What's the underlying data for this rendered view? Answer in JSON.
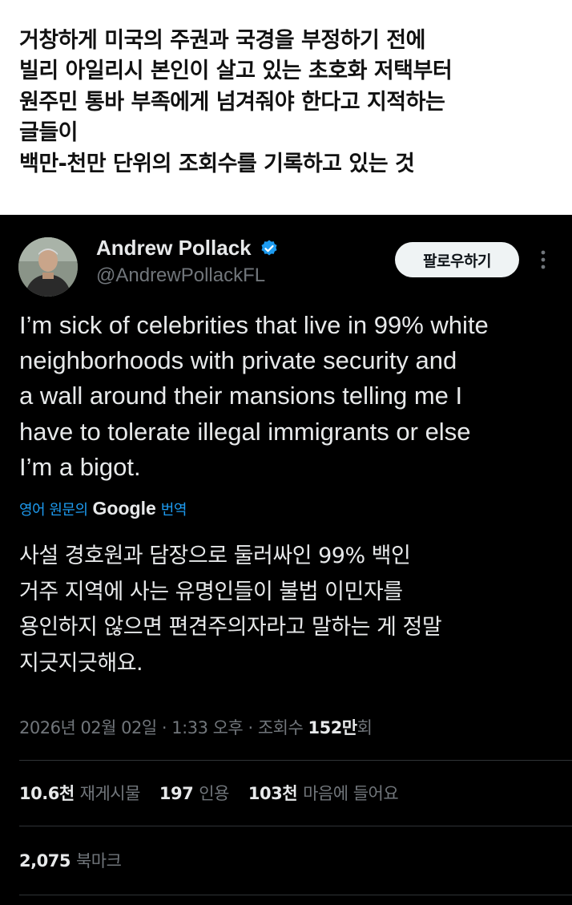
{
  "caption": {
    "lines": [
      "거창하게 미국의 주권과 국경을 부정하기 전에",
      "빌리 아일리시 본인이 살고 있는 초호화 저택부터",
      "원주민 통바 부족에게 넘겨줘야 한다고 지적하는",
      "글들이",
      "백만-천만 단위의 조회수를 기록하고 있는 것"
    ]
  },
  "tweet": {
    "author": {
      "display_name": "Andrew Pollack",
      "handle": "@AndrewPollackFL",
      "verified_icon": "verified-badge-icon",
      "verified_color": "#1d9bf0"
    },
    "follow_button_label": "팔로우하기",
    "more_icon": "more-vertical-icon",
    "text_lines": [
      "I’m sick of celebrities that live in 99% white",
      "neighborhoods with private security and",
      "a wall around their mansions telling me I",
      "have to tolerate illegal immigrants or else",
      "I’m a bigot."
    ],
    "translation": {
      "prefix": "영어 원문의",
      "google": "Google",
      "suffix": "번역",
      "link_color": "#1d9bf0",
      "lines": [
        "사설 경호원과 담장으로 둘러싸인 99% 백인",
        "거주 지역에 사는 유명인들이 불법 이민자를",
        "용인하지 않으면 편견주의자라고 말하는 게 정말",
        "지긋지긋해요."
      ]
    },
    "meta": {
      "date": "2026년 02월 02일",
      "separator": "·",
      "time": "1:33 오후",
      "views_label": "조회수",
      "views_count": "152만",
      "views_suffix": "회"
    },
    "stats": {
      "reposts_count": "10.6천",
      "reposts_label": "재게시물",
      "quotes_count": "197",
      "quotes_label": "인용",
      "likes_count": "103천",
      "likes_label": "마음에 들어요",
      "bookmarks_count": "2,075",
      "bookmarks_label": "북마크"
    }
  }
}
